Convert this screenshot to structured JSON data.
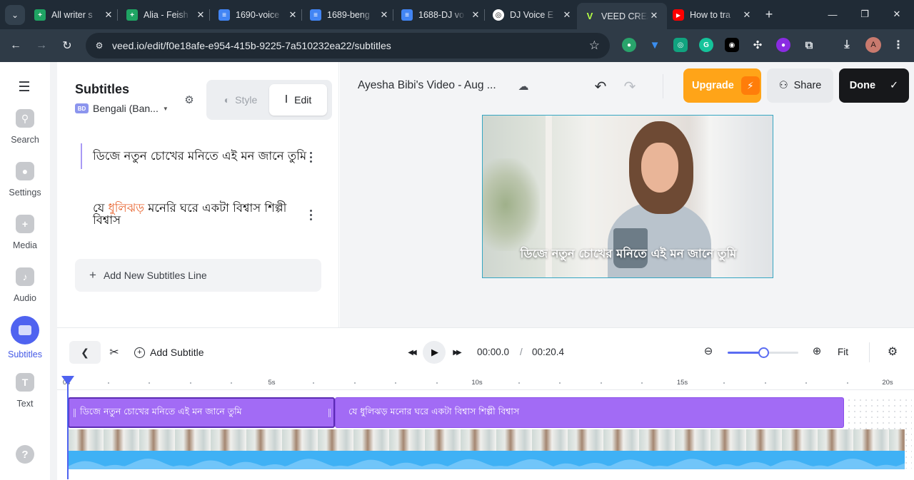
{
  "browser": {
    "tabs": [
      {
        "title": "All writer s",
        "icon": "sheets-icon",
        "color": "#1fa463"
      },
      {
        "title": "Alia - Feish",
        "icon": "sheets-icon",
        "color": "#1fa463"
      },
      {
        "title": "1690-voice",
        "icon": "docs-icon",
        "color": "#4285f4"
      },
      {
        "title": "1689-beng",
        "icon": "docs-icon",
        "color": "#4285f4"
      },
      {
        "title": "1688-DJ vo",
        "icon": "docs-icon",
        "color": "#4285f4"
      },
      {
        "title": "DJ Voice E",
        "icon": "openai-icon",
        "color": "#ffffff"
      },
      {
        "title": "VEED CREA",
        "icon": "veed-icon",
        "color": "#b5ff45"
      },
      {
        "title": "How to tra",
        "icon": "youtube-icon",
        "color": "#ff0000"
      }
    ],
    "url": "veed.io/edit/f0e18afe-e954-415b-9225-7a510232ea22/subtitles",
    "profile_initial": "A"
  },
  "leftnav": {
    "items": [
      {
        "label": "Search",
        "icon": "search-icon"
      },
      {
        "label": "Settings",
        "icon": "settings-icon"
      },
      {
        "label": "Media",
        "icon": "plus-icon"
      },
      {
        "label": "Audio",
        "icon": "music-icon"
      },
      {
        "label": "Subtitles",
        "icon": "subtitles-icon"
      },
      {
        "label": "Text",
        "icon": "text-icon"
      }
    ]
  },
  "panel": {
    "title": "Subtitles",
    "language_code": "BD",
    "language": "Bengali (Ban...",
    "mode_style": "Style",
    "mode_edit": "Edit",
    "lines": [
      {
        "text": "ডিজে নতুন চোখের মনিতে এই মন জানে তুমি"
      },
      {
        "pre": "যে ",
        "highlight": "ধুলিঝড়",
        "post": " মনেরি ঘরে একটা বিশ্বাস শিল্পী বিশ্বাস"
      }
    ],
    "add_line": "Add New Subtitles Line"
  },
  "header": {
    "project_title": "Ayesha Bibi's Video - Aug ...",
    "upgrade": "Upgrade",
    "share": "Share",
    "done": "Done",
    "accent_upgrade": "#ffa418"
  },
  "video": {
    "caption": "ডিজে নতুন চোখের মনিতে এই মন জানে তুমি"
  },
  "timeline": {
    "add_subtitle": "Add Subtitle",
    "current_time": "00:00.0",
    "separator": "/",
    "total_time": "00:20.4",
    "fit": "Fit",
    "zoom_level": 0.5,
    "ruler_labels": [
      "0s",
      "5s",
      "10s",
      "15s",
      "20s"
    ],
    "tracks": [
      "ডিজে নতুন চোখের মনিতে এই মন জানে তুমি",
      "যে ধুলিঝড় মনোর ঘরে একটা বিশ্বাস শিল্পী বিশ্বাস"
    ]
  }
}
